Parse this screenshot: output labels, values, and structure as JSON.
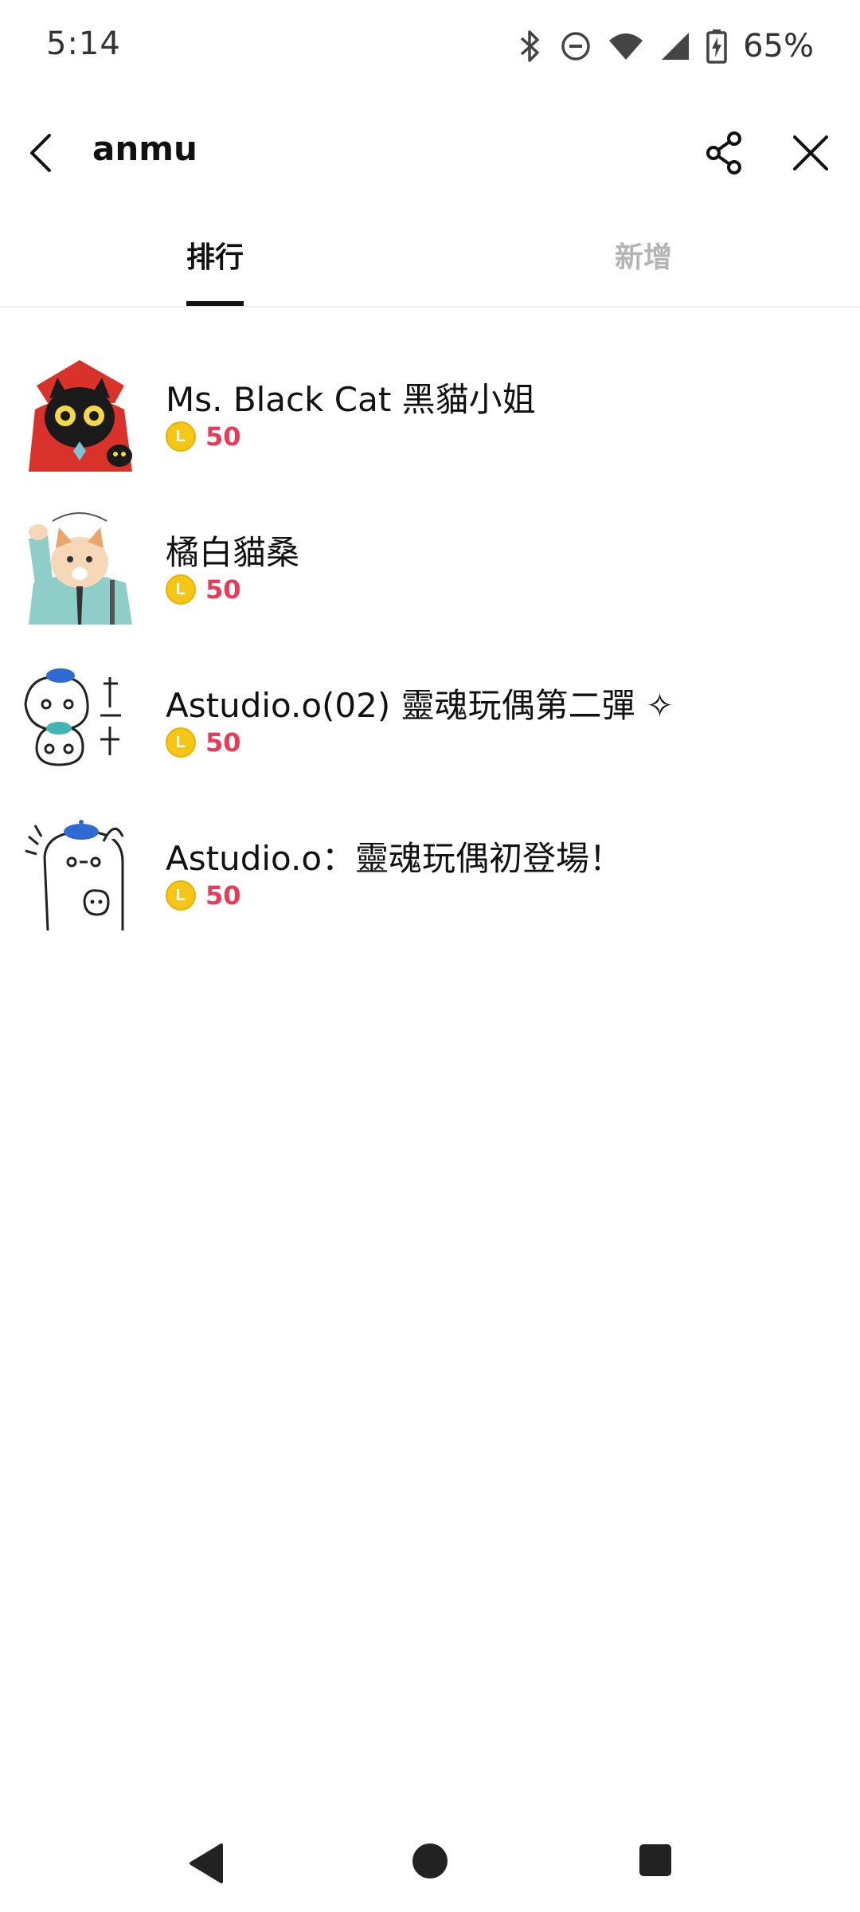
{
  "status_bar": {
    "time": "5:14",
    "battery": "65%",
    "icons": [
      "bluetooth-icon",
      "do-not-disturb-icon",
      "wifi-icon",
      "cell-signal-icon",
      "battery-charging-icon"
    ]
  },
  "header": {
    "title": "anmu",
    "back_icon": "chevron-left-icon",
    "share_icon": "share-icon",
    "close_icon": "close-icon"
  },
  "tabs": [
    {
      "label": "排行",
      "active": true
    },
    {
      "label": "新增",
      "active": false
    }
  ],
  "items": [
    {
      "title": "Ms. Black Cat 黑貓小姐",
      "price": "50",
      "coin_glyph": "L",
      "thumb": "black-cat-red-hood"
    },
    {
      "title": "橘白貓桑",
      "price": "50",
      "coin_glyph": "L",
      "thumb": "orange-white-cat-suit"
    },
    {
      "title": "Astudio.o(02) 靈魂玩偶第二彈 ✧",
      "price": "50",
      "coin_glyph": "L",
      "thumb": "soul-doll-ghosts"
    },
    {
      "title": "Astudio.o：靈魂玩偶初登場！",
      "price": "50",
      "coin_glyph": "L",
      "thumb": "soul-doll-beret"
    }
  ],
  "colors": {
    "price": "#ea3a58",
    "coin": "#f5c518",
    "active_tab": "#111111",
    "inactive_tab": "#b5b5b5"
  },
  "nav": {
    "back_icon": "nav-back-icon",
    "home_icon": "nav-home-icon",
    "recents_icon": "nav-recents-icon"
  }
}
